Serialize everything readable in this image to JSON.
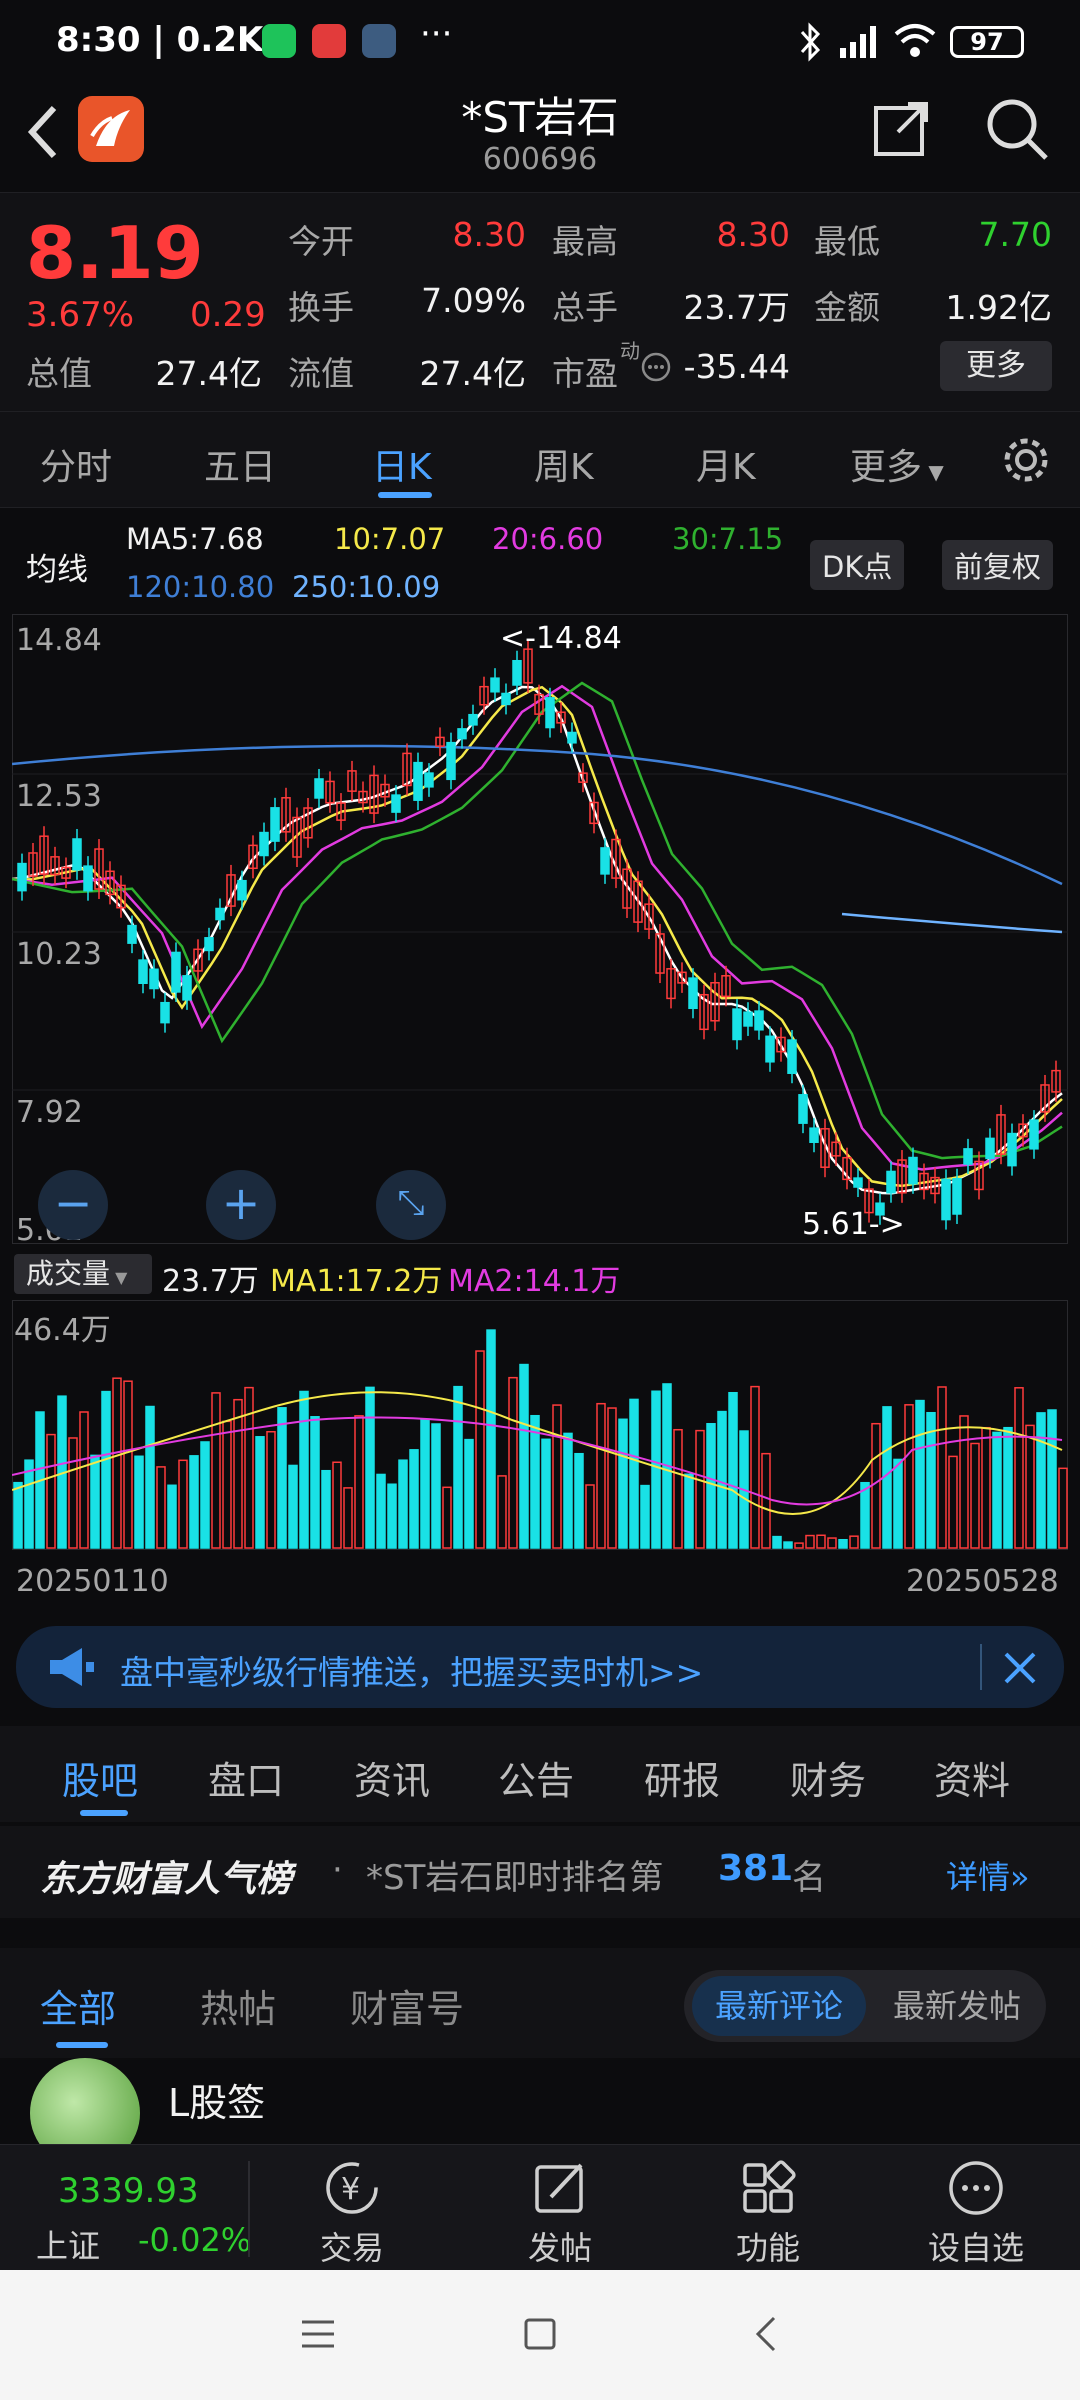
{
  "status": {
    "time": "8:30",
    "speed": "0.2K/s",
    "battery": "97",
    "icons": [
      "wechat-icon",
      "toutiao-icon",
      "settings-app-icon",
      "more-dots-icon",
      "bluetooth-icon",
      "signal-icon",
      "wifi-icon",
      "battery-icon"
    ]
  },
  "header": {
    "title": "*ST岩石",
    "code": "600696"
  },
  "quote": {
    "price": "8.19",
    "change_pct": "3.67%",
    "change": "0.29",
    "open_label": "今开",
    "open": "8.30",
    "high_label": "最高",
    "high": "8.30",
    "low_label": "最低",
    "low": "7.70",
    "turnover_label": "换手",
    "turnover": "7.09%",
    "volume_label": "总手",
    "volume": "23.7万",
    "amount_label": "金额",
    "amount": "1.92亿",
    "mktcap_label": "总值",
    "mktcap": "27.4亿",
    "float_label": "流值",
    "float": "27.4亿",
    "pe_label": "市盈",
    "pe_super": "动",
    "pe": "-35.44",
    "more": "更多"
  },
  "kline_tabs": [
    "分时",
    "五日",
    "日K",
    "周K",
    "月K",
    "更多"
  ],
  "kline_active": 2,
  "ma": {
    "label": "均线",
    "ma5": "MA5:7.68",
    "ma10": "10:7.07",
    "ma20": "20:6.60",
    "ma30": "30:7.15",
    "ma120": "120:10.80",
    "ma250": "250:10.09",
    "dk_button": "DK点",
    "adjust_button": "前复权"
  },
  "colors": {
    "up": "#ff3b3b",
    "down": "#19e1e6",
    "ma5": "#ffffff",
    "ma10": "#f5e94a",
    "ma20": "#e23be0",
    "ma30": "#2fb12f",
    "ma120": "#3f7fd6",
    "ma250": "#6fb3ff",
    "accent": "#3e9bff"
  },
  "chart_data": {
    "type": "candlestick",
    "y_ticks": [
      "14.84",
      "12.53",
      "10.23",
      "7.92",
      "5.61"
    ],
    "ylim": [
      5.61,
      14.84
    ],
    "max_marker": "<-14.84",
    "min_marker": "5.61->",
    "volume_label": "成交量",
    "volume_value": "23.7万",
    "vol_ma1": "MA1:17.2万",
    "vol_ma2": "MA2:14.1万",
    "vol_max": "46.4万",
    "x_start": "20250110",
    "x_end": "20250528"
  },
  "banner": {
    "text": "盘中毫秒级行情推送，把握买卖时机>>"
  },
  "section_tabs": [
    "股吧",
    "盘口",
    "资讯",
    "公告",
    "研报",
    "财务",
    "资料"
  ],
  "rank": {
    "brand": "东方财富人气榜",
    "dot": "·",
    "text_prefix": "*ST岩石即时排名第",
    "rank": "381",
    "text_suffix": "名",
    "detail": "详情"
  },
  "feed_tabs": [
    "全部",
    "热帖",
    "财富号"
  ],
  "feed_sort": [
    "最新评论",
    "最新发帖"
  ],
  "post": {
    "author": "L股签"
  },
  "bottom": {
    "index_value": "3339.93",
    "index_name": "上证",
    "index_change": "-0.02%",
    "items": [
      "交易",
      "发帖",
      "功能",
      "设自选"
    ]
  }
}
